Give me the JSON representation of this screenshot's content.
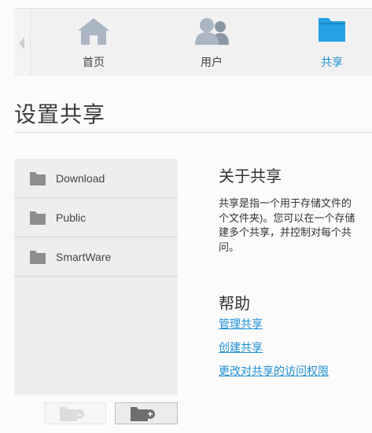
{
  "nav": {
    "tabs": [
      {
        "label": "首页",
        "icon": "home-icon",
        "active": false
      },
      {
        "label": "用户",
        "icon": "users-icon",
        "active": false
      },
      {
        "label": "共享",
        "icon": "folder-icon",
        "active": true
      }
    ]
  },
  "page": {
    "title": "设置共享"
  },
  "shares": [
    {
      "name": "Download",
      "icon": "folder-icon"
    },
    {
      "name": "Public",
      "icon": "folder-icon"
    },
    {
      "name": "SmartWare",
      "icon": "folder-icon"
    }
  ],
  "actions": {
    "remove_icon": "folder-minus-icon",
    "add_icon": "folder-plus-icon"
  },
  "about": {
    "heading": "关于共享",
    "lines": [
      "共享是指一个用于存储文件的",
      "个文件夹)。您可以在一个存储",
      "建多个共享，并控制对每个共",
      "问。"
    ]
  },
  "help": {
    "heading": "帮助",
    "links": [
      "管理共享",
      "创建共享",
      "更改对共享的访问权限"
    ]
  },
  "colors": {
    "accent": "#1e8fd6",
    "active_folder": "#23a3e6",
    "inactive_icon": "#aab6c2",
    "list_folder": "#8e8e8e"
  }
}
